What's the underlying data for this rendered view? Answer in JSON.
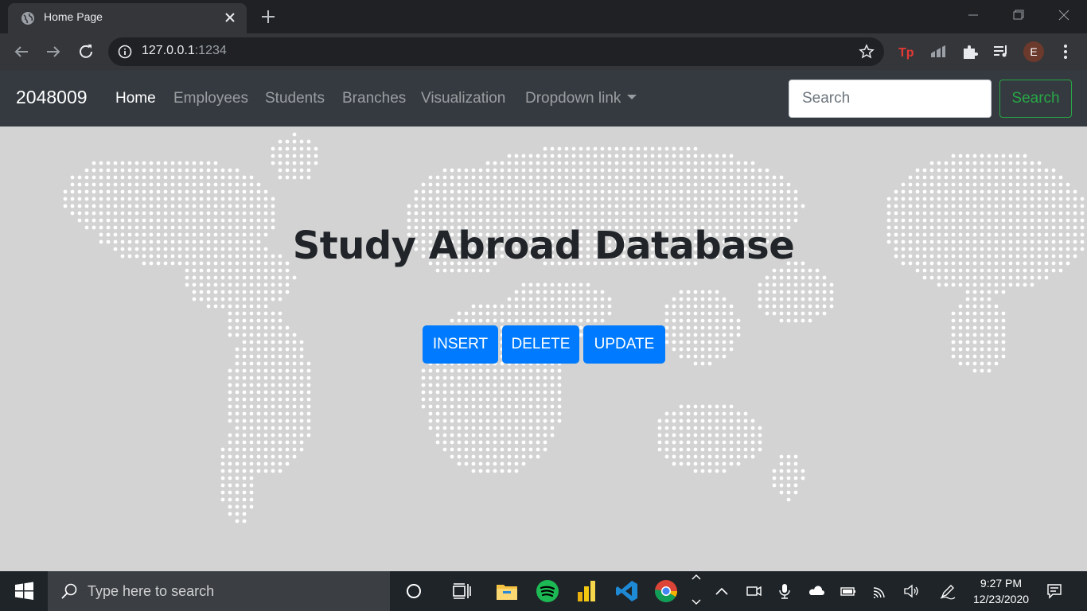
{
  "browser": {
    "tab_title": "Home Page",
    "url_host": "127.0.0.1",
    "url_port": ":1234",
    "profile_initial": "E"
  },
  "navbar": {
    "brand": "2048009",
    "links": [
      "Home",
      "Employees",
      "Students",
      "Branches",
      "Visualization",
      "Dropdown link"
    ],
    "active_link": "Home",
    "search_placeholder": "Search",
    "search_button": "Search"
  },
  "hero": {
    "title": "Study Abroad Database",
    "buttons": [
      "INSERT",
      "DELETE",
      "UPDATE"
    ]
  },
  "taskbar": {
    "search_placeholder": "Type here to search",
    "time": "9:27 PM",
    "date": "12/23/2020"
  },
  "colors": {
    "navbar_bg": "#343a40",
    "primary": "#007bff",
    "success": "#28a745",
    "page_bg": "#d3d3d3"
  }
}
